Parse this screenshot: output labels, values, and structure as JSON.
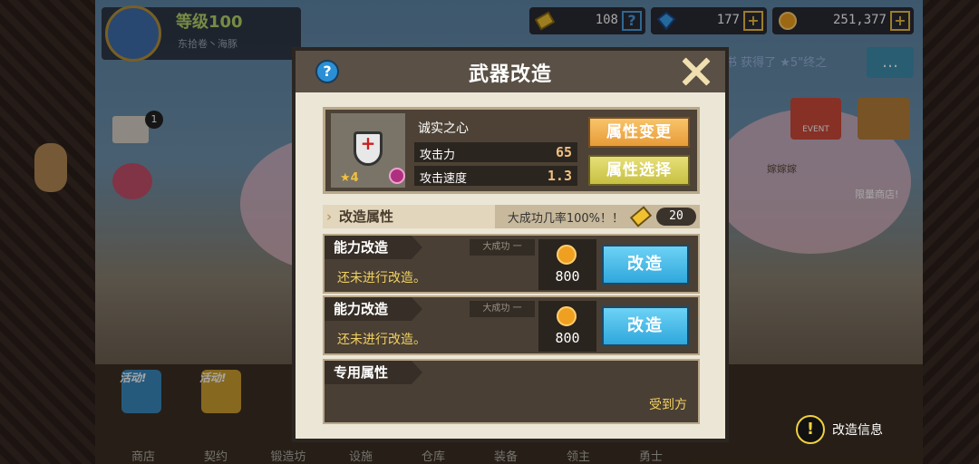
{
  "player": {
    "level": "等级100",
    "name": "东拾卷丶海豚"
  },
  "currencies": [
    {
      "icon": "ticket-icon",
      "value": "108",
      "action": "?"
    },
    {
      "icon": "gem-icon",
      "value": "177",
      "action": "+"
    },
    {
      "icon": "gold-coin-icon",
      "value": "251,377",
      "action": "+"
    }
  ],
  "mail": {
    "badge": "1"
  },
  "ticker": "书 获得了 ★5\"终之",
  "event_label": "EVENT",
  "sign_label": "嫁嫁嫁",
  "shop_label": "限量商店!",
  "bottom_nav": [
    "商店",
    "契约",
    "锻造坊",
    "设施",
    "仓库",
    "装备",
    "领主",
    "勇士"
  ],
  "activity_tags": [
    "活动!",
    "活动!"
  ],
  "modal": {
    "title": "武器改造",
    "weapon": {
      "name": "诚实之心",
      "stars": "★4",
      "stats": [
        {
          "label": "攻击力",
          "value": "65"
        },
        {
          "label": "攻击速度",
          "value": "1.3"
        }
      ],
      "change_button": "属性变更",
      "select_button": "属性选择"
    },
    "section": {
      "title": "改造属性",
      "success_rate": "大成功几率100%！！",
      "ticket_count": "20"
    },
    "slots": [
      {
        "title": "能力改造",
        "status": "还未进行改造。",
        "badge": "大成功 一",
        "cost": "800",
        "button": "改造"
      },
      {
        "title": "能力改造",
        "status": "还未进行改造。",
        "badge": "大成功 一",
        "cost": "800",
        "button": "改造"
      }
    ],
    "special": {
      "title": "专用属性",
      "recipient": "受到方"
    }
  },
  "info_button": {
    "icon": "!",
    "label": "改造信息"
  },
  "colors": {
    "accent_blue": "#2fa7dc",
    "accent_orange": "#e89b38",
    "status_yellow": "#f0d060"
  }
}
